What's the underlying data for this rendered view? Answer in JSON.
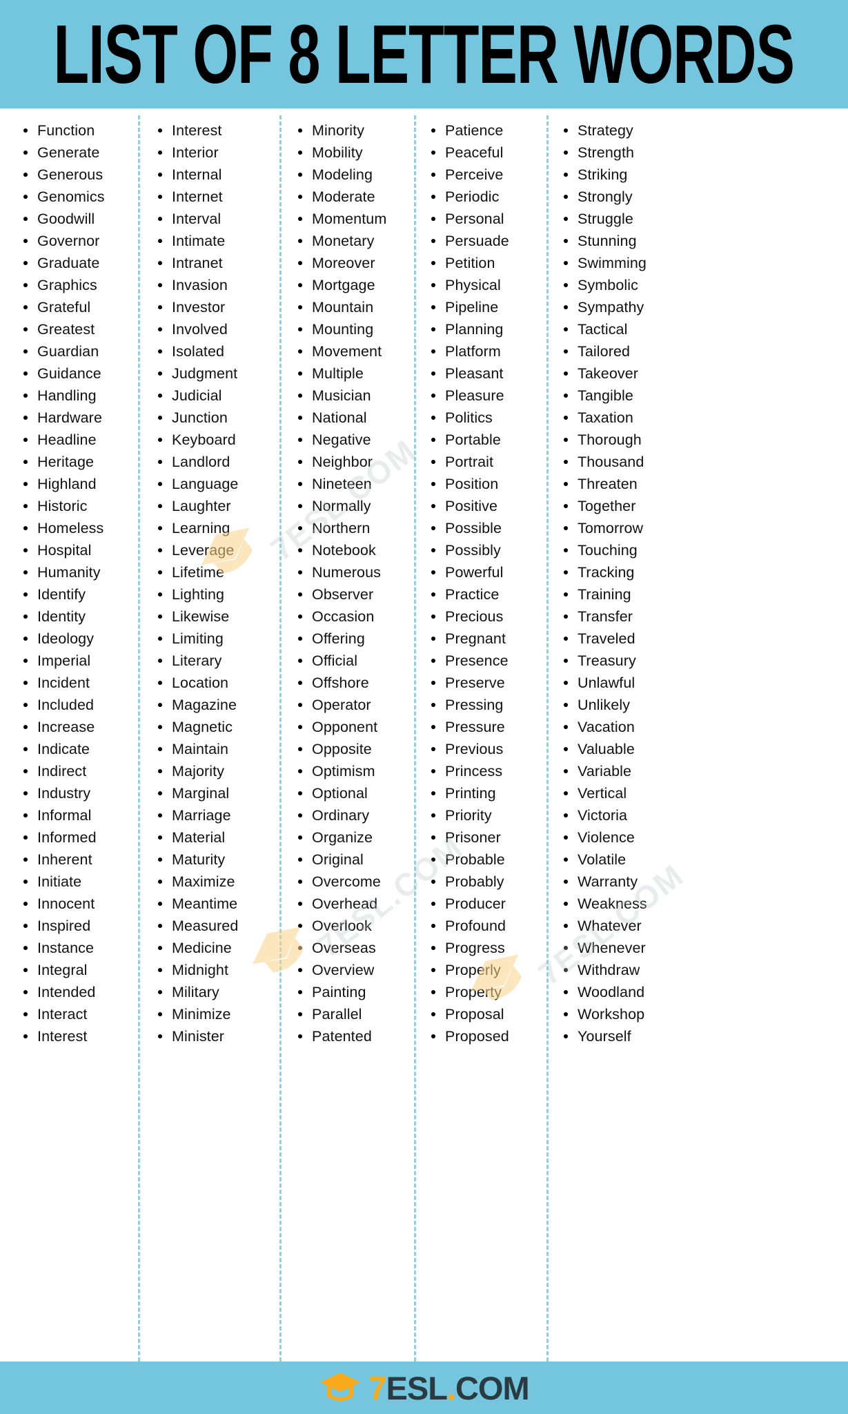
{
  "header": {
    "title": "LIST OF 8 LETTER WORDS",
    "background_color": "#73c6de",
    "text_color": "#000000"
  },
  "footer": {
    "background_color": "#73c6de",
    "logo": {
      "seven": "7",
      "name": "ESL",
      "dot": ".",
      "tld": "COM",
      "full_text": "7ESL.COM",
      "cap_color": "#f9aa1b",
      "text_color": "#2b3a40"
    }
  },
  "watermarks": [
    {
      "text": "7ESL.COM"
    },
    {
      "text": "7ESL.COM"
    },
    {
      "text": "7ESL.COM"
    }
  ],
  "divider": {
    "style": "dashed",
    "color": "#8fd0e4"
  },
  "columns": [
    {
      "id": "column-1",
      "words": [
        "Function",
        "Generate",
        "Generous",
        "Genomics",
        "Goodwill",
        "Governor",
        "Graduate",
        "Graphics",
        "Grateful",
        "Greatest",
        "Guardian",
        "Guidance",
        "Handling",
        "Hardware",
        "Headline",
        "Heritage",
        "Highland",
        "Historic",
        "Homeless",
        "Hospital",
        "Humanity",
        "Identify",
        "Identity",
        "Ideology",
        "Imperial",
        "Incident",
        "Included",
        "Increase",
        "Indicate",
        "Indirect",
        "Industry",
        "Informal",
        "Informed",
        "Inherent",
        "Initiate",
        "Innocent",
        "Inspired",
        "Instance",
        "Integral",
        "Intended",
        "Interact",
        "Interest"
      ]
    },
    {
      "id": "column-2",
      "words": [
        "Interest",
        "Interior",
        "Internal",
        "Internet",
        "Interval",
        "Intimate",
        "Intranet",
        "Invasion",
        "Investor",
        "Involved",
        "Isolated",
        "Judgment",
        "Judicial",
        "Junction",
        "Keyboard",
        "Landlord",
        "Language",
        "Laughter",
        "Learning",
        "Leverage",
        "Lifetime",
        "Lighting",
        "Likewise",
        "Limiting",
        "Literary",
        "Location",
        "Magazine",
        "Magnetic",
        "Maintain",
        "Majority",
        "Marginal",
        "Marriage",
        "Material",
        "Maturity",
        "Maximize",
        "Meantime",
        "Measured",
        "Medicine",
        "Midnight",
        "Military",
        "Minimize",
        "Minister"
      ]
    },
    {
      "id": "column-3",
      "words": [
        "Minority",
        "Mobility",
        "Modeling",
        "Moderate",
        "Momentum",
        "Monetary",
        "Moreover",
        "Mortgage",
        "Mountain",
        "Mounting",
        "Movement",
        "Multiple",
        "Musician",
        "National",
        "Negative",
        "Neighbor",
        "Nineteen",
        "Normally",
        "Northern",
        "Notebook",
        "Numerous",
        "Observer",
        "Occasion",
        "Offering",
        "Official",
        "Offshore",
        "Operator",
        "Opponent",
        "Opposite",
        "Optimism",
        "Optional",
        "Ordinary",
        "Organize",
        "Original",
        "Overcome",
        "Overhead",
        "Overlook",
        "Overseas",
        "Overview",
        "Painting",
        "Parallel",
        "Patented"
      ]
    },
    {
      "id": "column-4",
      "words": [
        "Patience",
        "Peaceful",
        "Perceive",
        "Periodic",
        "Personal",
        "Persuade",
        "Petition",
        "Physical",
        "Pipeline",
        "Planning",
        "Platform",
        "Pleasant",
        "Pleasure",
        "Politics",
        "Portable",
        "Portrait",
        "Position",
        "Positive",
        "Possible",
        "Possibly",
        "Powerful",
        "Practice",
        "Precious",
        "Pregnant",
        "Presence",
        "Preserve",
        "Pressing",
        "Pressure",
        "Previous",
        "Princess",
        "Printing",
        "Priority",
        "Prisoner",
        "Probable",
        "Probably",
        "Producer",
        "Profound",
        "Progress",
        "Properly",
        "Property",
        "Proposal",
        "Proposed"
      ]
    },
    {
      "id": "column-5",
      "words": [
        "Strategy",
        "Strength",
        "Striking",
        "Strongly",
        "Struggle",
        "Stunning",
        "Swimming",
        "Symbolic",
        "Sympathy",
        "Tactical",
        "Tailored",
        "Takeover",
        "Tangible",
        "Taxation",
        "Thorough",
        "Thousand",
        "Threaten",
        "Together",
        "Tomorrow",
        "Touching",
        "Tracking",
        "Training",
        "Transfer",
        "Traveled",
        "Treasury",
        "Unlawful",
        "Unlikely",
        "Vacation",
        "Valuable",
        "Variable",
        "Vertical",
        "Victoria",
        "Violence",
        "Volatile",
        "Warranty",
        "Weakness",
        "Whatever",
        "Whenever",
        "Withdraw",
        "Woodland",
        "Workshop",
        "Yourself"
      ]
    }
  ]
}
